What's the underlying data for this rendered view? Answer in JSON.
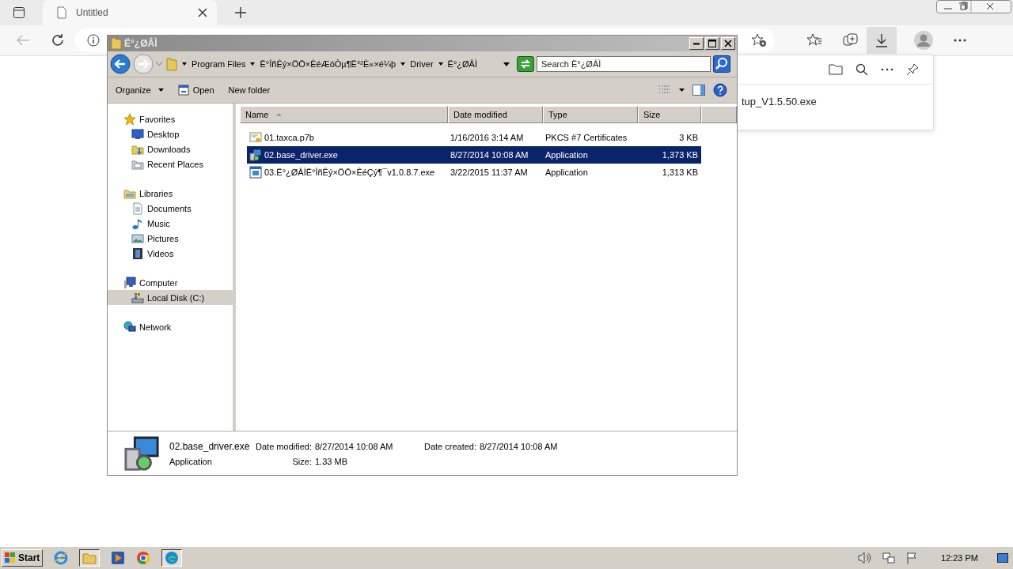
{
  "browser": {
    "tab": {
      "title": "Untitled"
    },
    "downloads": {
      "file": "tup_V1.5.50.exe"
    }
  },
  "explorer": {
    "title": "Ë°¿ØÂÌ",
    "breadcrumb": [
      "Program Files",
      "Ë°ÎñÊý×ÖÖ×ÊéÆóÒµ¶Ë°²È«×é¼þ",
      "Driver",
      "Ë°¿ØÂÌ"
    ],
    "search": {
      "placeholder": "Search Ë°¿ØÂÌ"
    },
    "toolbar": [
      {
        "label": "Organize",
        "kind": "menu"
      },
      {
        "label": "Open",
        "kind": "open"
      },
      {
        "label": "New folder",
        "kind": "plain"
      }
    ],
    "nav": [
      {
        "label": "Favorites",
        "kind": "star",
        "selected": false,
        "children": [
          {
            "label": "Desktop",
            "kind": "desktop",
            "selected": false
          },
          {
            "label": "Downloads",
            "kind": "downloads",
            "selected": false
          },
          {
            "label": "Recent Places",
            "kind": "recent",
            "selected": false
          }
        ]
      },
      {
        "label": "Libraries",
        "kind": "library",
        "selected": false,
        "children": [
          {
            "label": "Documents",
            "kind": "documents",
            "selected": false
          },
          {
            "label": "Music",
            "kind": "music",
            "selected": false
          },
          {
            "label": "Pictures",
            "kind": "pictures",
            "selected": false
          },
          {
            "label": "Videos",
            "kind": "videos",
            "selected": false
          }
        ]
      },
      {
        "label": "Computer",
        "kind": "computer",
        "selected": false,
        "children": [
          {
            "label": "Local Disk (C:)",
            "kind": "disk",
            "selected": true
          }
        ]
      },
      {
        "label": "Network",
        "kind": "network",
        "selected": false
      }
    ],
    "columns": [
      {
        "label": "Name",
        "sorted": true
      },
      {
        "label": "Date modified",
        "sorted": false
      },
      {
        "label": "Type",
        "sorted": false
      },
      {
        "label": "Size",
        "sorted": false
      }
    ],
    "files": [
      {
        "name": "01.taxca.p7b",
        "date": "1/16/2016 3:14 AM",
        "type": "PKCS #7 Certificates",
        "size": "3 KB",
        "kind": "certificate",
        "selected": false
      },
      {
        "name": "02.base_driver.exe",
        "date": "8/27/2014 10:08 AM",
        "type": "Application",
        "size": "1,373 KB",
        "kind": "installer",
        "selected": true
      },
      {
        "name": "03.Ë°¿ØÂÌË°ÎñÊý×ÖÖ×ÊéÇý¶¯v1.0.8.7.exe",
        "date": "3/22/2015 11:37 AM",
        "type": "Application",
        "size": "1,313 KB",
        "kind": "app",
        "selected": false
      }
    ],
    "details": {
      "name": "02.base_driver.exe",
      "type": "Application",
      "modified_label": "Date modified:",
      "modified": "8/27/2014 10:08 AM",
      "created_label": "Date created:",
      "created": "8/27/2014 10:08 AM",
      "size_label": "Size:",
      "size": "1.33 MB"
    }
  },
  "taskbar": {
    "start": "Start",
    "clock": "12:23 PM"
  }
}
